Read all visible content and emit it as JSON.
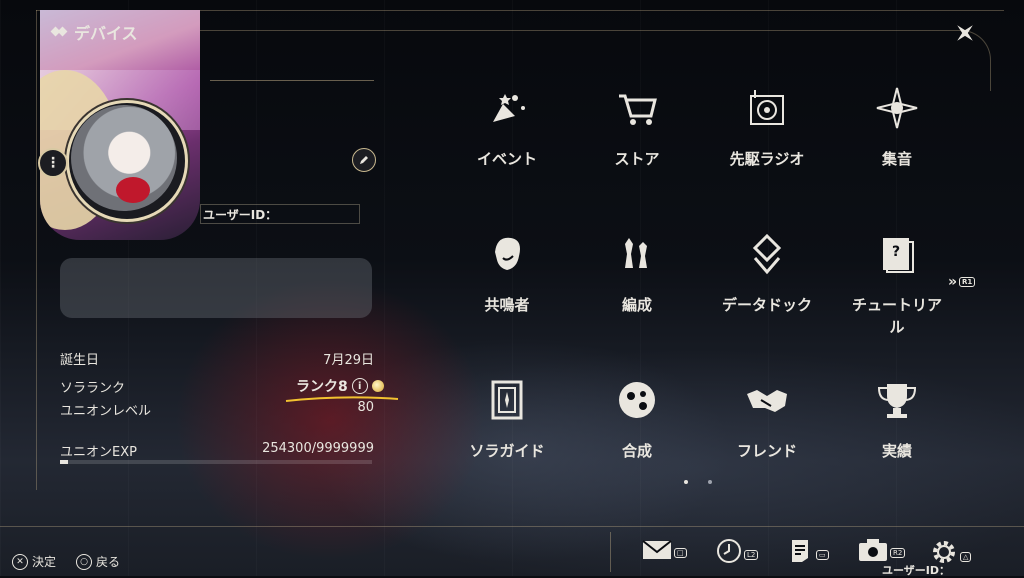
{
  "header": {
    "title": "デバイス"
  },
  "profile": {
    "uid_label": "ユーザーID：",
    "stats": [
      {
        "label": "誕生日",
        "value": "7月29日"
      },
      {
        "label": "ソラランク",
        "value": "ランク8"
      },
      {
        "label": "ユニオンレベル",
        "value": "80"
      },
      {
        "label": "ユニオンEXP",
        "value": "254300/9999999"
      }
    ],
    "exp_fraction": 0.025
  },
  "menu": {
    "items": [
      {
        "label": "イベント",
        "icon": "event-icon"
      },
      {
        "label": "ストア",
        "icon": "store-cart-icon"
      },
      {
        "label": "先駆ラジオ",
        "icon": "radio-icon"
      },
      {
        "label": "集音",
        "icon": "sound-collect-icon"
      },
      {
        "label": "共鳴者",
        "icon": "resonator-icon"
      },
      {
        "label": "編成",
        "icon": "team-icon"
      },
      {
        "label": "データドック",
        "icon": "data-dock-icon"
      },
      {
        "label": "チュートリアル",
        "icon": "tutorial-icon"
      },
      {
        "label": "ソラガイド",
        "icon": "guide-book-icon"
      },
      {
        "label": "合成",
        "icon": "synthesis-icon"
      },
      {
        "label": "フレンド",
        "icon": "handshake-icon"
      },
      {
        "label": "実績",
        "icon": "trophy-icon"
      }
    ],
    "next_page_tag": "R1"
  },
  "footer": {
    "confirm": "決定",
    "back": "戻る",
    "uid_label": "ユーザーID：",
    "tags": {
      "clock": "L2",
      "camera": "R2"
    }
  },
  "colors": {
    "accent": "#d9c9a0",
    "highlight": "#f2c230"
  }
}
